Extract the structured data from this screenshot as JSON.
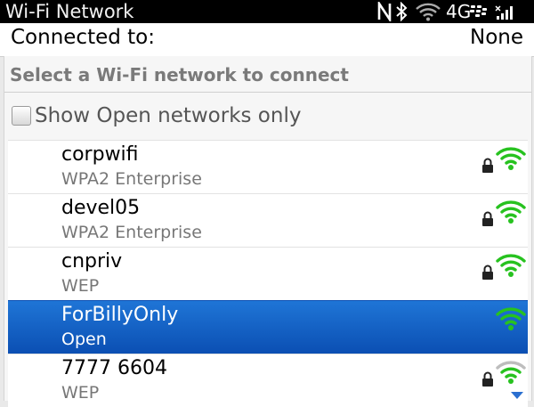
{
  "statusbar": {
    "title": "Wi-Fi Network",
    "network_label": "4G",
    "icons": [
      "nfc-icon",
      "bluetooth-icon",
      "wifi-icon",
      "network-4g",
      "blackberry-logo-icon",
      "signal-bars-icon"
    ]
  },
  "connected": {
    "label": "Connected to:",
    "value": "None"
  },
  "section_title": "Select a Wi-Fi network to connect",
  "filter": {
    "label": "Show Open networks only",
    "checked": false
  },
  "networks": [
    {
      "ssid": "corpwifi",
      "security": "WPA2 Enterprise",
      "locked": true,
      "signal_level": 4,
      "selected": false
    },
    {
      "ssid": "devel05",
      "security": "WPA2 Enterprise",
      "locked": true,
      "signal_level": 4,
      "selected": false
    },
    {
      "ssid": "cnpriv",
      "security": "WEP",
      "locked": true,
      "signal_level": 4,
      "selected": false
    },
    {
      "ssid": "ForBillyOnly",
      "security": "Open",
      "locked": false,
      "signal_level": 4,
      "selected": true
    },
    {
      "ssid": "7777 6604",
      "security": "WEP",
      "locked": true,
      "signal_level": 3,
      "selected": false
    }
  ],
  "colors": {
    "selected_bg": "#1565d2",
    "signal_green": "#27c21f",
    "signal_gray": "#bdbdbd",
    "status_bar": "#000000"
  }
}
